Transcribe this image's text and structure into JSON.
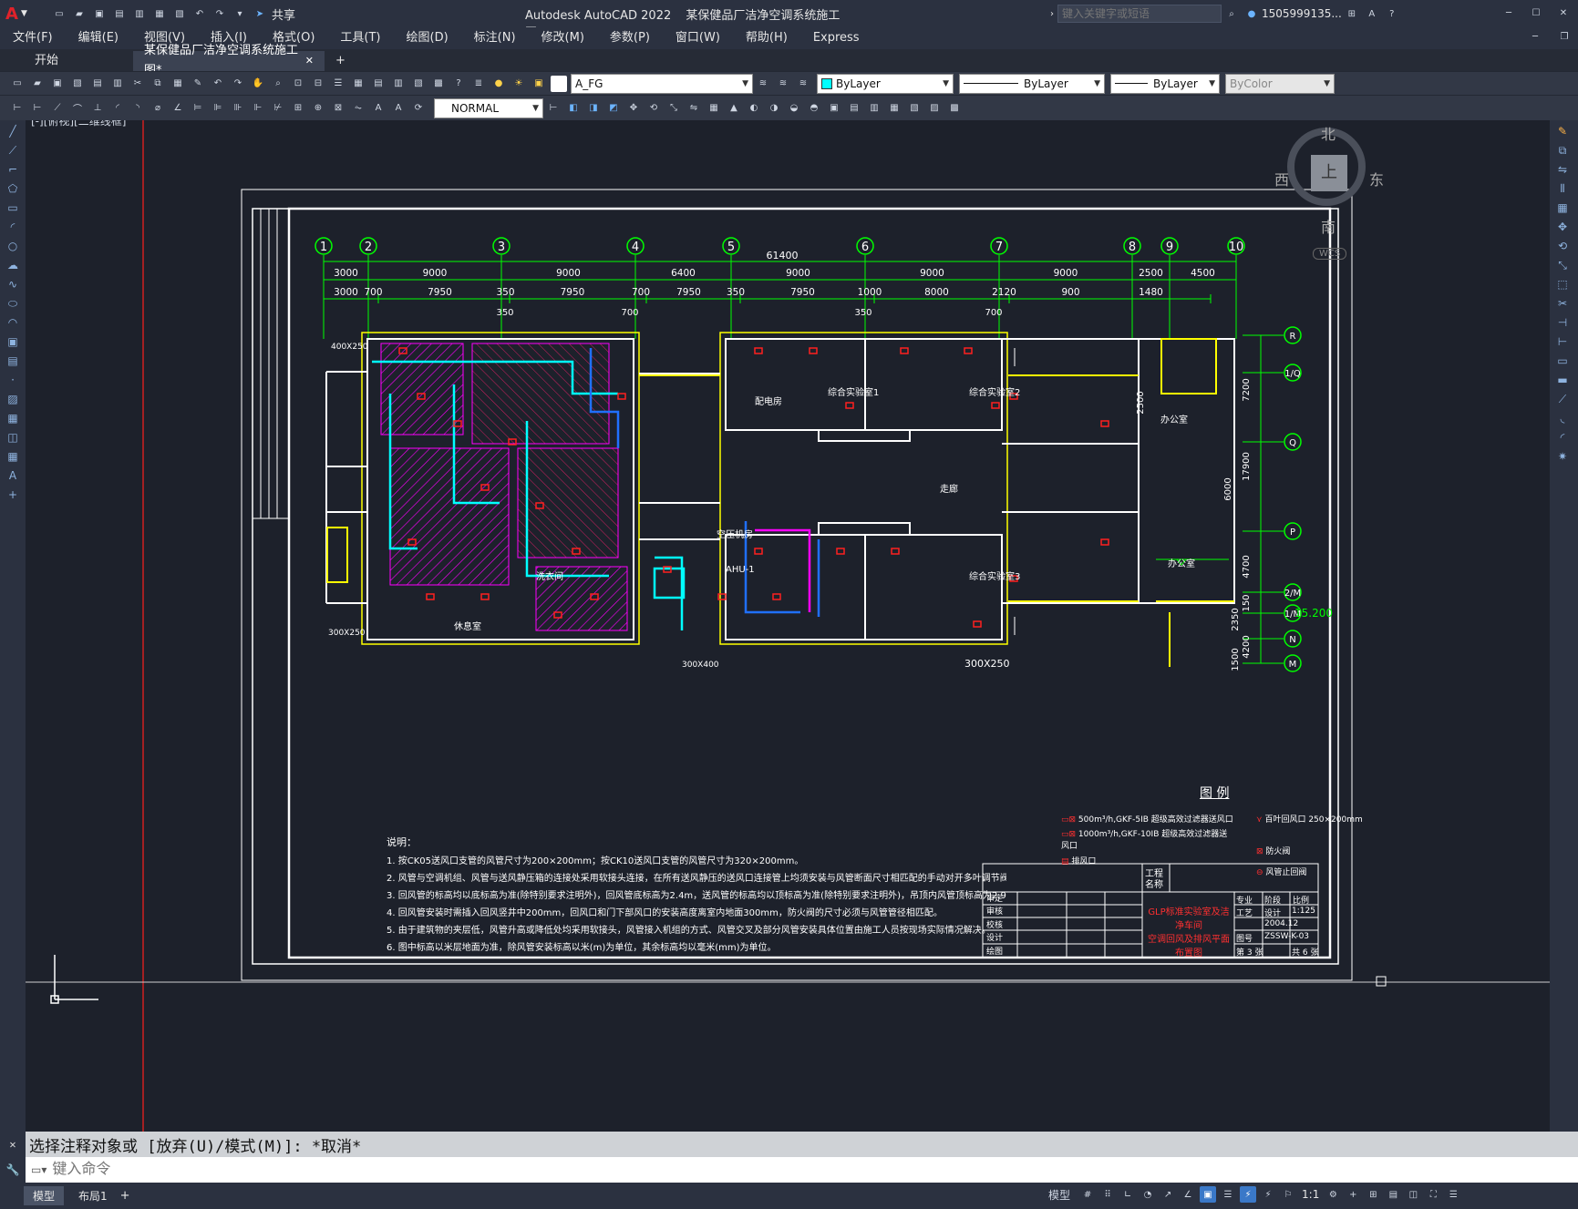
{
  "app": {
    "title": "Autodesk AutoCAD 2022",
    "file": "某保健品厂洁净空调系统施工图.dwg",
    "share": "共享",
    "search_placeholder": "键入关键字或短语",
    "user": "1505999135...",
    "logo": "A"
  },
  "menu": [
    "文件(F)",
    "编辑(E)",
    "视图(V)",
    "插入(I)",
    "格式(O)",
    "工具(T)",
    "绘图(D)",
    "标注(N)",
    "修改(M)",
    "参数(P)",
    "窗口(W)",
    "帮助(H)",
    "Express"
  ],
  "tabs": {
    "start": "开始",
    "doc": "某保健品厂洁净空调系统施工图*",
    "add": "+"
  },
  "toolbar": {
    "layer": "A_FG",
    "color": "ByLayer",
    "linetype": "ByLayer",
    "lineweight": "ByLayer",
    "plotstyle": "ByColor",
    "dimstyle": "NORMAL"
  },
  "viewport": {
    "label": "[-][俯视][二维线框]",
    "compass_n": "北",
    "compass_s": "南",
    "compass_e": "东",
    "compass_w": "西",
    "compass_top": "上",
    "wcs": "WCS"
  },
  "drawing": {
    "axes_top": [
      "1",
      "2",
      "3",
      "4",
      "5",
      "6",
      "7",
      "8",
      "9",
      "10"
    ],
    "axes_right": [
      "R",
      "1/Q",
      "Q",
      "P",
      "2/M",
      "1/M",
      "N",
      "M"
    ],
    "overall": "61400",
    "dims1": [
      "3000",
      "9000",
      "9000",
      "6400",
      "9000",
      "9000",
      "9000",
      "2500",
      "4500"
    ],
    "dims2": [
      "3000",
      "700",
      "7950",
      "350",
      "7950",
      "700",
      "7950",
      "350",
      "7950",
      "1000",
      "8000",
      "2120",
      "900",
      "1480"
    ],
    "dims_sub": [
      "350",
      "700",
      "350",
      "700"
    ],
    "right_dims": [
      "7200",
      "17900",
      "6000",
      "4700",
      "150",
      "2350",
      "4200",
      "1500",
      "2500"
    ],
    "level": "15.200",
    "ducts": [
      "400X250",
      "300X250",
      "300X400",
      "300X250"
    ],
    "rooms": [
      "综合实验室1",
      "综合实验室2",
      "综合实验室3",
      "办公室",
      "办公室",
      "走廊",
      "洗衣间",
      "空压机房",
      "配电房",
      "休息室",
      "AHU-1"
    ],
    "legend_title": "图 例",
    "legend": [
      "500m³/h,GKF-5IB 超级高效过滤器送风口",
      "1000m³/h,GKF-10IB 超级高效过滤器送风口",
      "百叶回风口 250×200mm",
      "防火阀",
      "排风口",
      "风管止回阀"
    ],
    "notes_title": "说明：",
    "notes": [
      "1. 按CK05送风口支管的风管尺寸为200×200mm；按CK10送风口支管的风管尺寸为320×200mm。",
      "2. 风管与空调机组、风管与送风静压箱的连接处采用软接头连接，在所有送风静压的送风口连接管上均须安装与风管断面尺寸相匹配的手动对开多叶调节阀。",
      "3. 回风管的标高均以底标高为准(除特别要求注明外)，回风管底标高为2.4m，送风管的标高均以顶标高为准(除特别要求注明外)，吊顶内风管顶标高为2.95m。",
      "4. 回风管安装时需插入回风竖井中200mm，回风口和门下部风口的安装高度离室内地面300mm，防火阀的尺寸必须与风管管径相匹配。",
      "5. 由于建筑物的夹层低，风管升高或降低处均采用软接头，风管接入机组的方式、风管交叉及部分风管安装具体位置由施工人员按现场实际情况解决。",
      "6. 图中标高以米层地面为准，除风管安装标高以米(m)为单位，其余标高均以毫米(mm)为单位。"
    ],
    "titleblock": {
      "project": "工程名称",
      "dwgtitle": "GLP标准实验室及洁净车间",
      "sub": "空调回风及排风平面布置图",
      "scale": "1:125",
      "date": "2004.12",
      "no": "ZSSW-K-03",
      "sheet": "第 3 张",
      "total": "共 6 张",
      "major": "专业",
      "stage": "阶段",
      "ratio": "比例",
      "craft": "工艺",
      "design": "设计",
      "drawno": "图号",
      "rows": [
        "审定",
        "审核",
        "校核",
        "设计",
        "绘图"
      ]
    }
  },
  "command": {
    "history": "选择注释对象或 [放弃(U)/模式(M)]: *取消*",
    "placeholder": "键入命令"
  },
  "status": {
    "model": "模型",
    "layout1": "布局1",
    "add": "+",
    "scale": "1:1"
  },
  "colors": {
    "bg": "#1d212b",
    "grid": "#00ff00",
    "wall": "#ffffff",
    "accent": "#ff00ff",
    "red": "#ff2020",
    "yellow": "#ffff00",
    "cyan": "#00ffff"
  }
}
